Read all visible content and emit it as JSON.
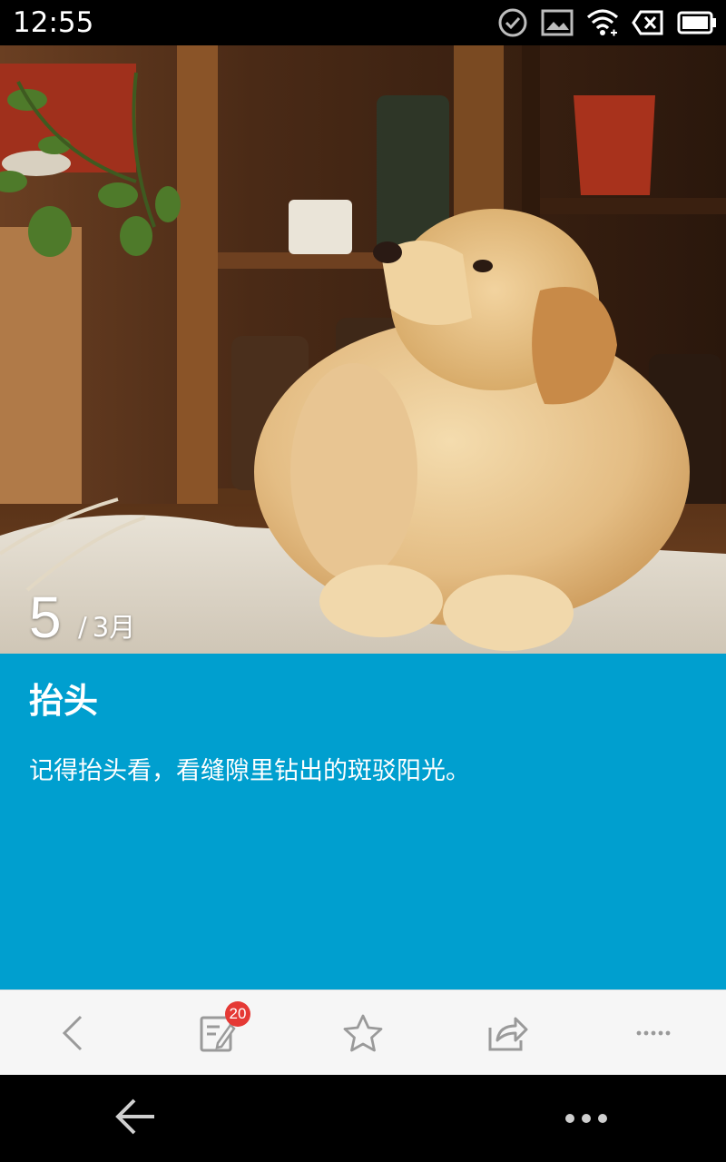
{
  "status_bar": {
    "time": "12:55",
    "icons": [
      "sync-check-icon",
      "image-icon",
      "wifi-icon",
      "no-sim-icon",
      "battery-icon"
    ]
  },
  "hero": {
    "image": "golden-retriever-puppy-photo",
    "date": {
      "day": "5",
      "slash": "/",
      "month": "3月"
    }
  },
  "article": {
    "title": "抬头",
    "body": "记得抬头看，看缝隙里钻出的斑驳阳光。",
    "background_color": "#009fcf"
  },
  "toolbar": {
    "buttons": [
      "back-icon",
      "comment-icon",
      "star-icon",
      "share-icon",
      "more-icon"
    ],
    "comment_badge": "20",
    "badge_color": "#e53935",
    "icon_color": "#9a9a9a"
  },
  "system_nav": {
    "buttons": [
      "system-back-icon",
      "system-menu-icon"
    ]
  }
}
